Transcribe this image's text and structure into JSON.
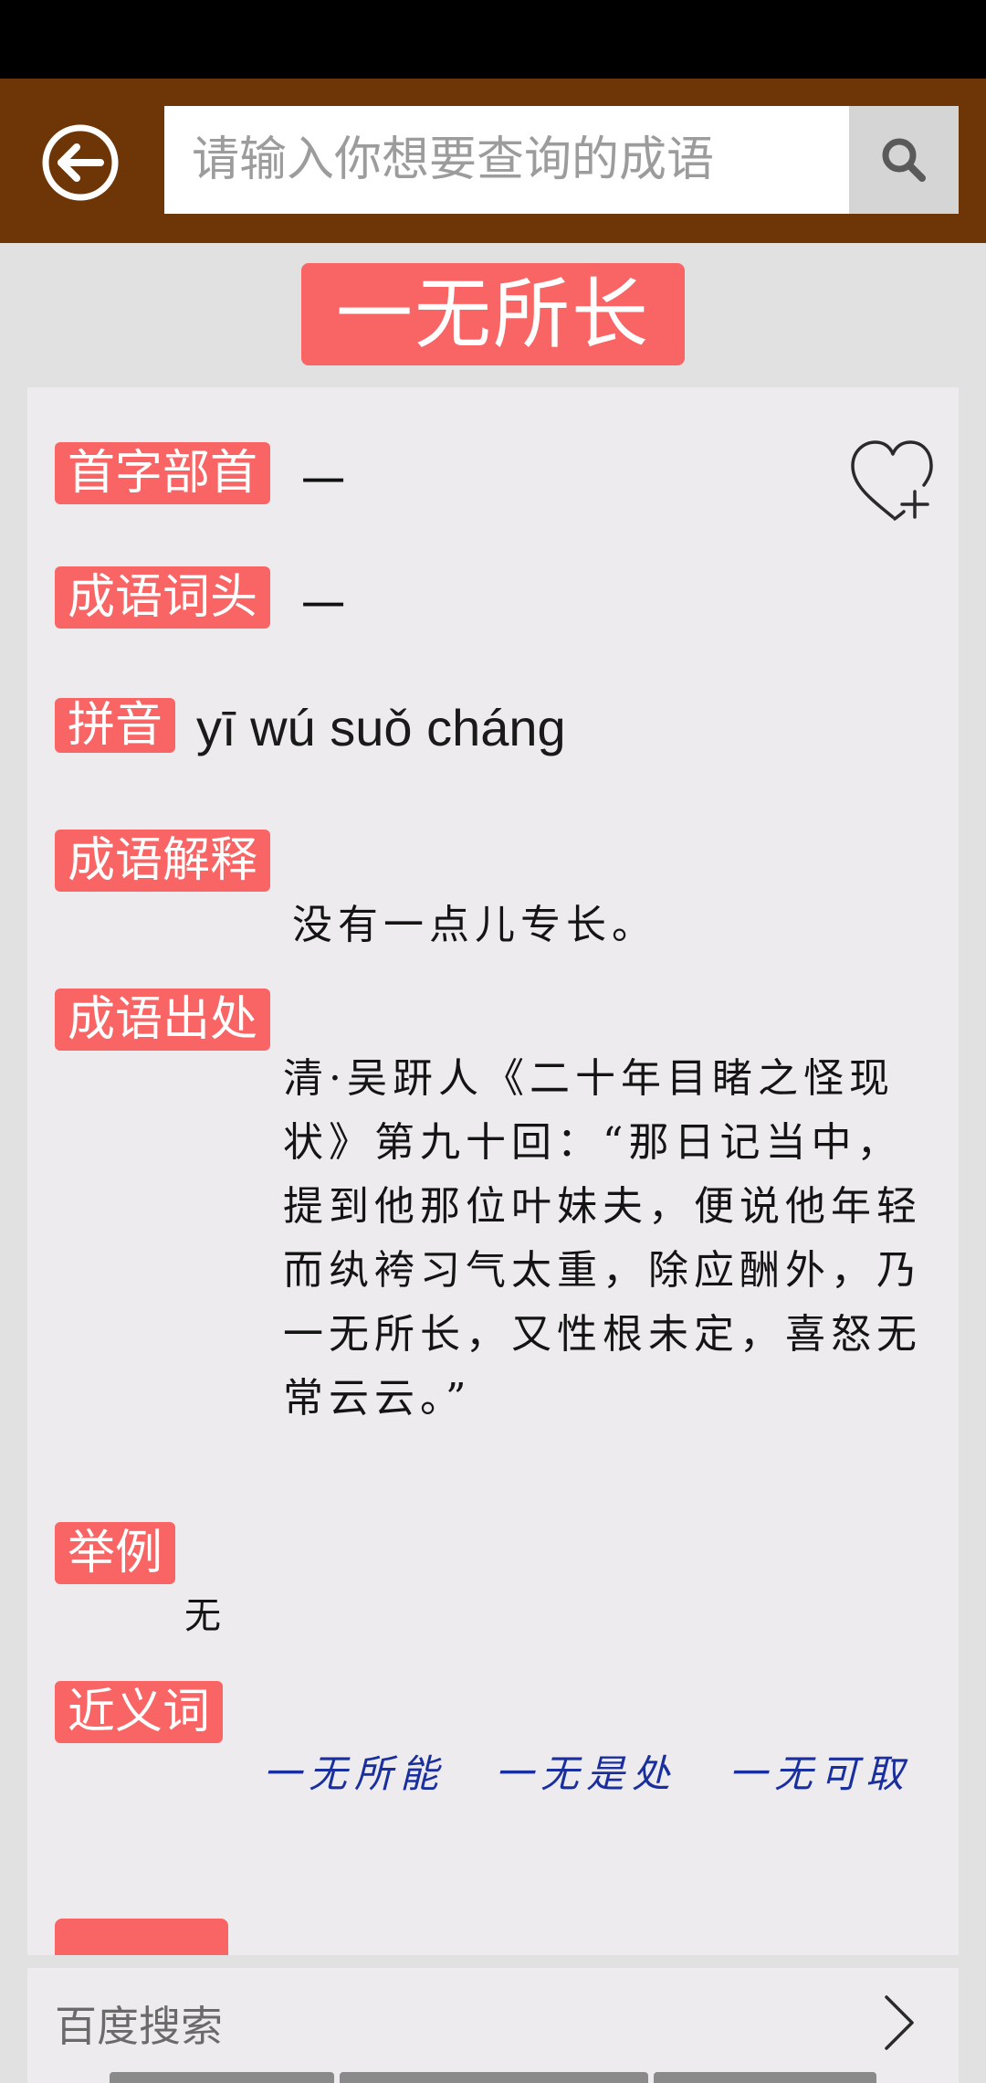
{
  "header": {
    "search_placeholder": "请输入你想要查询的成语"
  },
  "idiom": {
    "title": "一无所长",
    "sections": {
      "first_radical": {
        "label": "首字部首",
        "value": "一"
      },
      "head_char": {
        "label": "成语词头",
        "value": "一"
      },
      "pinyin": {
        "label": "拼音",
        "value": "yī wú suǒ cháng"
      },
      "explanation": {
        "label": "成语解释",
        "value": "没有一点儿专长。"
      },
      "source": {
        "label": "成语出处",
        "value": "清·吴趼人《二十年目睹之怪现状》第九十回：“那日记当中，提到他那位叶妹夫，便说他年轻而纨袴习气太重，除应酬外，乃一无所长，又性根未定，喜怒无常云云。”"
      },
      "example": {
        "label": "举例",
        "value": "无"
      },
      "synonyms": {
        "label": "近义词",
        "items": [
          "一无所能",
          "一无是处",
          "一无可取"
        ]
      }
    }
  },
  "footer": {
    "baidu_label": "百度搜索"
  },
  "icons": {
    "back": "back-arrow-circle-icon",
    "search": "search-icon",
    "favorite": "heart-plus-icon",
    "chevron": "chevron-right-icon"
  },
  "colors": {
    "header_bg": "#6e3506",
    "tag_bg": "#f96565",
    "synonym_text": "#1a2f9e"
  }
}
